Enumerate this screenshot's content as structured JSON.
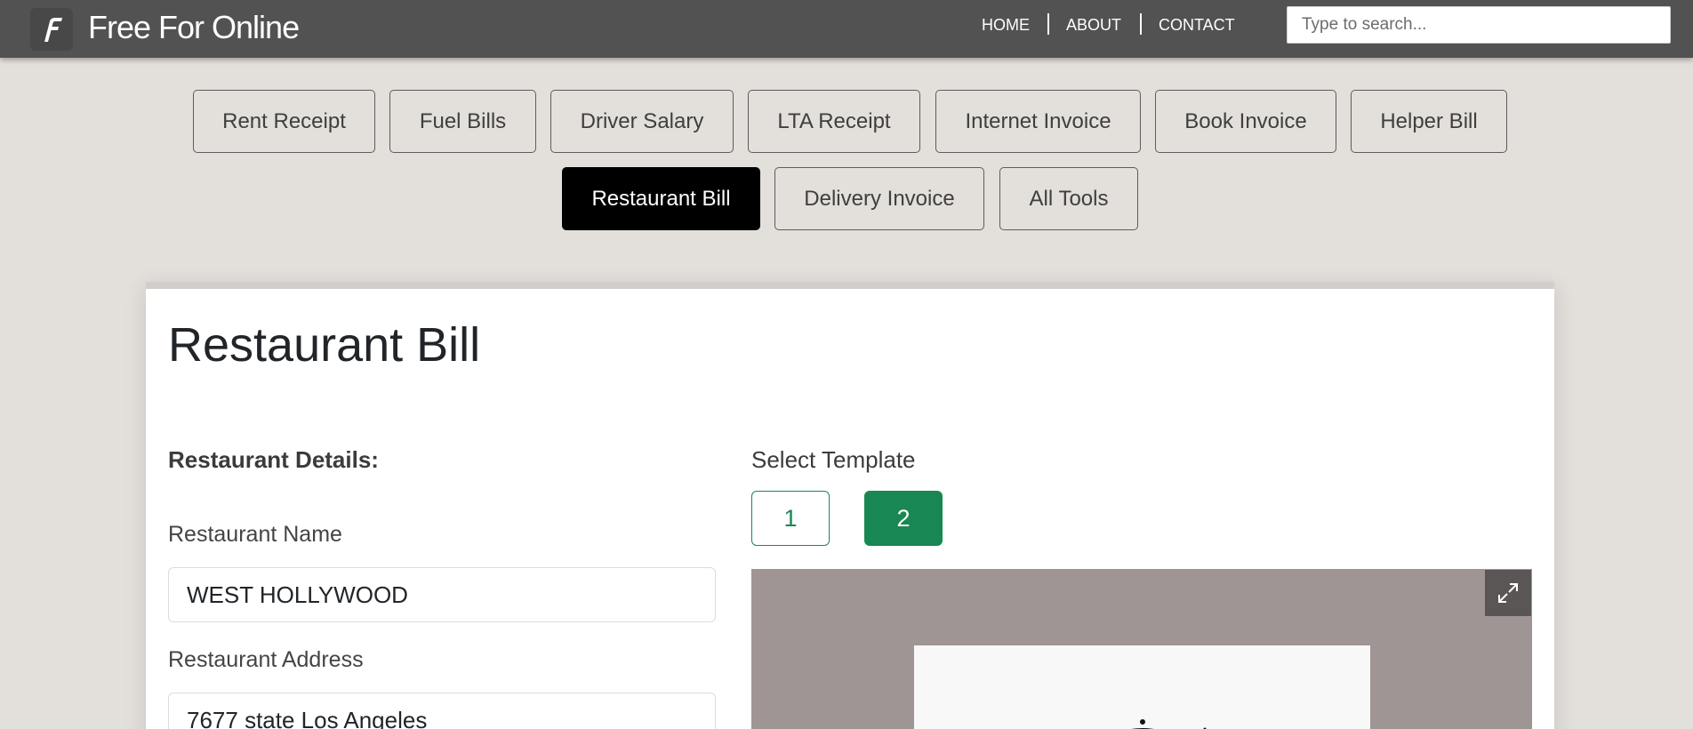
{
  "header": {
    "logo_letter": "F",
    "brand": "Free For Online",
    "nav": [
      "HOME",
      "ABOUT",
      "CONTACT"
    ],
    "search_placeholder": "Type to search..."
  },
  "tools": [
    {
      "label": "Rent Receipt",
      "active": false
    },
    {
      "label": "Fuel Bills",
      "active": false
    },
    {
      "label": "Driver Salary",
      "active": false
    },
    {
      "label": "LTA Receipt",
      "active": false
    },
    {
      "label": "Internet Invoice",
      "active": false
    },
    {
      "label": "Book Invoice",
      "active": false
    },
    {
      "label": "Helper Bill",
      "active": false
    },
    {
      "label": "Restaurant Bill",
      "active": true
    },
    {
      "label": "Delivery Invoice",
      "active": false
    },
    {
      "label": "All Tools",
      "active": false
    }
  ],
  "main": {
    "title": "Restaurant Bill",
    "section": "Restaurant Details:",
    "fields": [
      {
        "label": "Restaurant Name",
        "value": "WEST HOLLYWOOD"
      },
      {
        "label": "Restaurant Address",
        "value": "7677 state Los Angeles"
      }
    ],
    "template_label": "Select Template",
    "templates": [
      "1",
      "2"
    ],
    "selected_template": "2"
  },
  "colors": {
    "header_bg": "#525252",
    "page_bg": "#e3dfda",
    "active_tool_bg": "#000000",
    "template_accent": "#198754",
    "preview_bg": "#9f9594"
  },
  "icons": {
    "logo": "f-logo-icon",
    "expand": "expand-icon"
  }
}
